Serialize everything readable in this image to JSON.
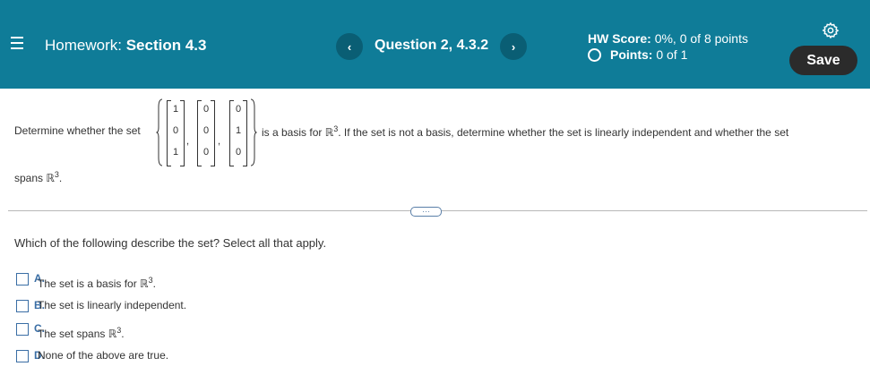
{
  "header": {
    "title_prefix": "Homework:",
    "title_section": "Section 4.3",
    "prev_label": "‹",
    "next_label": "›",
    "question_title": "Question 2, 4.3.2",
    "hw_score_label": "HW Score:",
    "hw_score_value": "0%, 0 of 8 points",
    "points_label": "Points:",
    "points_value": "0 of 1",
    "save_label": "Save",
    "colors": {
      "header_bg": "#0f7c98",
      "nav_btn_bg": "#0a5e74",
      "save_bg": "#2b2b2b"
    },
    "icons": [
      "menu-icon",
      "chevron-left-icon",
      "chevron-right-icon",
      "circle-icon",
      "gear-icon"
    ]
  },
  "question": {
    "intro": "Determine whether the set",
    "vectors": [
      [
        "1",
        "0",
        "1"
      ],
      [
        "0",
        "0",
        "0"
      ],
      [
        "0",
        "1",
        "0"
      ]
    ],
    "mid_text": "is a basis for",
    "space": "ℝ",
    "exponent": "3",
    "rest_text": ". If the set is not a basis, determine whether the set is linearly independent and whether the set",
    "spans_text": "spans",
    "period": "."
  },
  "more_button": "···",
  "prompt": "Which of the following describe the set? Select all that apply.",
  "options": [
    {
      "letter": "A.",
      "text": "The set is a basis for ℝ",
      "sup": "3",
      "end": "."
    },
    {
      "letter": "B.",
      "text": "The set is linearly independent.",
      "sup": "",
      "end": ""
    },
    {
      "letter": "C.",
      "text": "The set spans ℝ",
      "sup": "3",
      "end": "."
    },
    {
      "letter": "D.",
      "text": "None of the above are true.",
      "sup": "",
      "end": ""
    }
  ]
}
